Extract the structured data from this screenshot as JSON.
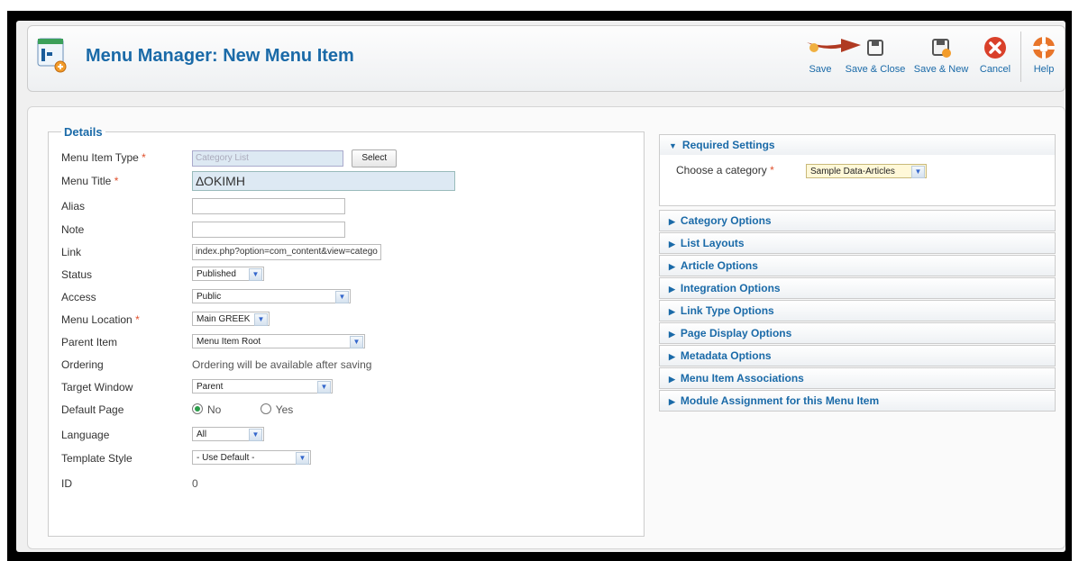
{
  "header": {
    "title": "Menu Manager: New Menu Item",
    "buttons": {
      "save": "Save",
      "save_close": "Save & Close",
      "save_new": "Save & New",
      "cancel": "Cancel",
      "help": "Help"
    }
  },
  "details": {
    "legend": "Details",
    "menu_item_type": {
      "label": "Menu Item Type",
      "value": "Category List",
      "button": "Select"
    },
    "menu_title": {
      "label": "Menu Title",
      "value": "ΔΟΚΙΜΗ"
    },
    "alias": {
      "label": "Alias",
      "value": ""
    },
    "note": {
      "label": "Note",
      "value": ""
    },
    "link": {
      "label": "Link",
      "value": "index.php?option=com_content&view=categor"
    },
    "status": {
      "label": "Status",
      "value": "Published"
    },
    "access": {
      "label": "Access",
      "value": "Public"
    },
    "menu_location": {
      "label": "Menu Location",
      "value": "Main GREEK"
    },
    "parent_item": {
      "label": "Parent Item",
      "value": "Menu Item Root"
    },
    "ordering": {
      "label": "Ordering",
      "value": "Ordering will be available after saving"
    },
    "target_window": {
      "label": "Target Window",
      "value": "Parent"
    },
    "default_page": {
      "label": "Default Page",
      "no": "No",
      "yes": "Yes",
      "selected": "No"
    },
    "language": {
      "label": "Language",
      "value": "All"
    },
    "template_style": {
      "label": "Template Style",
      "value": "- Use Default -"
    },
    "id": {
      "label": "ID",
      "value": "0"
    }
  },
  "panels": {
    "required": {
      "title": "Required Settings",
      "category_label": "Choose a category",
      "category_value": "Sample Data-Articles"
    },
    "items": [
      "Category Options",
      "List Layouts",
      "Article Options",
      "Integration Options",
      "Link Type Options",
      "Page Display Options",
      "Metadata Options",
      "Menu Item Associations",
      "Module Assignment for this Menu Item"
    ]
  },
  "colors": {
    "accent": "#1a6aa8",
    "required_star": "#e04f2b",
    "arrow": "#b03a22",
    "cancel_red": "#d9402a",
    "help_orange": "#e8752a"
  },
  "icons": [
    "menu-manager-icon",
    "save-icon",
    "save-close-icon",
    "save-new-icon",
    "cancel-icon",
    "help-icon",
    "arrow-icon"
  ]
}
